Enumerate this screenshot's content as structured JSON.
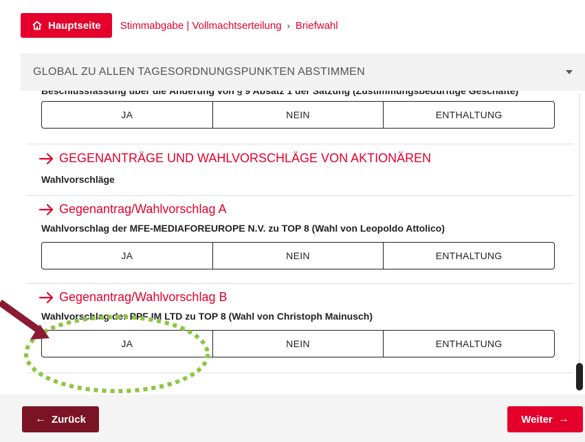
{
  "header": {
    "home_label": "Hauptseite",
    "breadcrumb": [
      "Stimmabgabe | Vollmachtserteilung",
      "Briefwahl"
    ],
    "breadcrumb_separator": "›"
  },
  "global_vote": {
    "label": "GLOBAL ZU ALLEN TAGESORDNUNGSPUNKTEN ABSTIMMEN"
  },
  "items": {
    "top_text": "Beschlussfassung über die Änderung von § 9 Absatz 1 der Satzung (Zustimmungsbedürftige Geschäfte)",
    "section_heading": "GEGENANTRÄGE UND WAHLVORSCHLÄGE VON AKTIONÄREN",
    "section_sub": "Wahlvorschläge",
    "a_heading": "Gegenantrag/Wahlvorschlag A",
    "a_text": "Wahlvorschlag der MFE-MEDIAFOREUROPE N.V. zu TOP 8 (Wahl von Leopoldo Attolico)",
    "b_heading": "Gegenantrag/Wahlvorschlag B",
    "b_text": "Wahlvorschlag der PPF IM LTD zu TOP 8 (Wahl von Christoph Mainusch)"
  },
  "vote_options": {
    "yes": "JA",
    "no": "NEIN",
    "abstain": "ENTHALTUNG"
  },
  "footer": {
    "back_label": "Zurück",
    "next_label": "Weiter",
    "back_arrow": "←",
    "next_arrow": "→"
  },
  "colors": {
    "brand_red": "#e4002b",
    "back_button": "#7a1424",
    "annotation_arrow": "#8b1a33",
    "annotation_circle": "#8dc63f"
  },
  "icons": [
    "home-icon",
    "arrow-right-icon",
    "chevron-down-icon",
    "arrow-left-icon"
  ]
}
